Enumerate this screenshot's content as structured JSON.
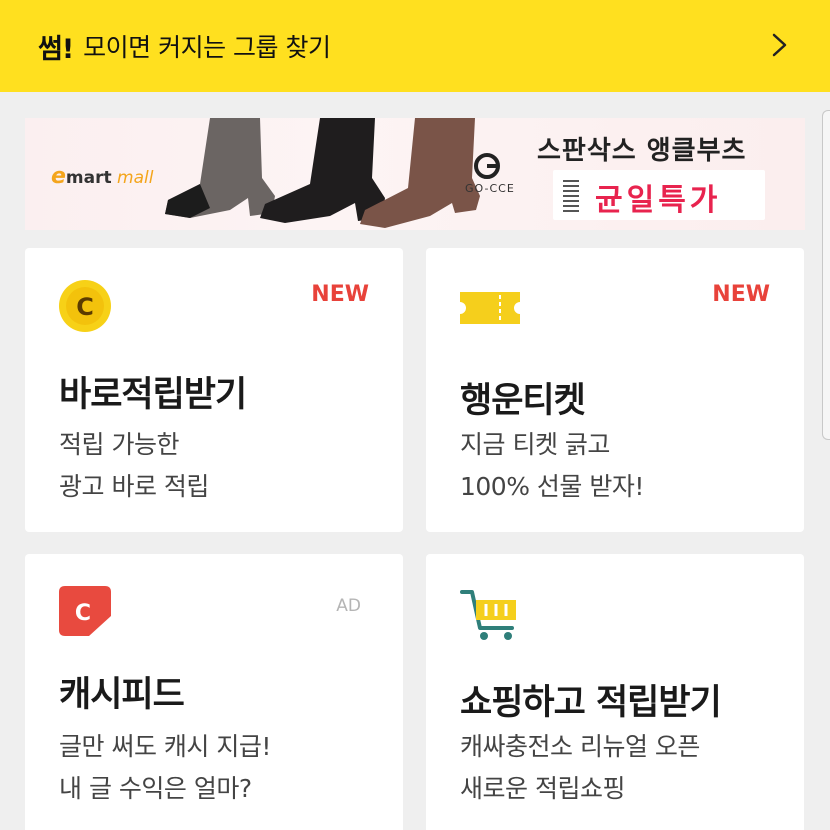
{
  "topbar": {
    "logo": "썸!",
    "title": "모이면 커지는 그룹 찾기",
    "chevron_icon": "chevron-right-icon"
  },
  "banner": {
    "store_prefix": "e",
    "store_name": "mart",
    "store_suffix": " mall",
    "brand": "GO-CCE",
    "headline": "스판삭스 앵클부츠",
    "sale_label": "균일특가",
    "colors": {
      "background": "#fbeff0",
      "sale_text": "#e8234e",
      "store_accent": "#f4a51c"
    }
  },
  "cards": [
    {
      "icon": "coin-c-icon",
      "badge": "NEW",
      "title": "바로적립받기",
      "desc_line1": "적립 가능한",
      "desc_line2": "광고 바로 적립"
    },
    {
      "icon": "ticket-icon",
      "badge": "NEW",
      "title": "행운티켓",
      "desc_line1": "지금 티켓 긁고",
      "desc_line2": "100% 선물 받자!"
    },
    {
      "icon": "cashfeed-icon",
      "badge": "AD",
      "title": "캐시피드",
      "desc_line1": "글만 써도 캐시 지급!",
      "desc_line2": "내 글 수익은 얼마?"
    },
    {
      "icon": "shopping-cart-icon",
      "badge": "",
      "title": "쇼핑하고 적립받기",
      "desc_line1": "캐싸충전소 리뉴얼 오픈",
      "desc_line2": "새로운 적립쇼핑"
    }
  ],
  "colors": {
    "topbar": "#ffe01f",
    "page_background": "#efefef",
    "new_badge": "#e8423a",
    "coin_yellow": "#f7d117",
    "ticket_yellow": "#f5cf1c",
    "cashfeed_red": "#e84a3f",
    "cart_teal": "#2f7f7a"
  }
}
